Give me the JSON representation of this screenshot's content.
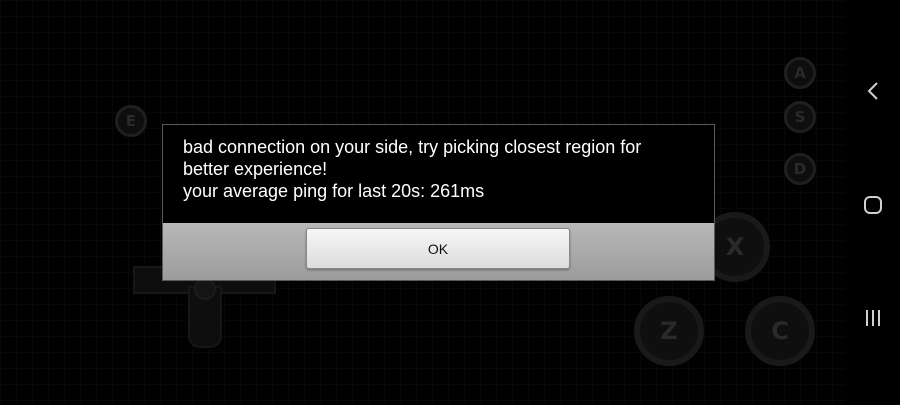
{
  "game": {
    "buttons": {
      "a": "A",
      "s": "S",
      "d": "D",
      "e": "E",
      "x": "X",
      "z": "Z",
      "c": "C"
    }
  },
  "dialog": {
    "message": "bad connection on your side, try picking closest region for\nbetter experience!\nyour average ping for last 20s: 261ms",
    "ok_label": "OK"
  },
  "navbar": {
    "icons": [
      "back-icon",
      "home-icon",
      "recent-apps-icon"
    ]
  },
  "colors": {
    "background": "#000000",
    "dialog_bar": "#a8a8a8",
    "dialog_text": "#ffffff"
  }
}
